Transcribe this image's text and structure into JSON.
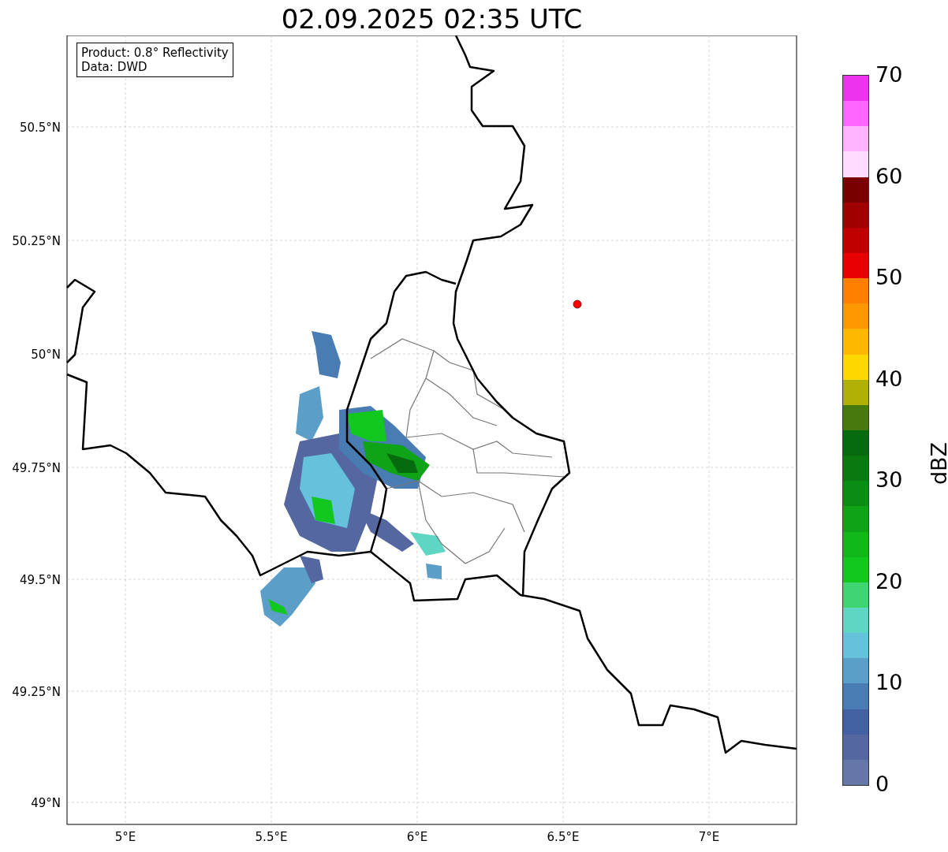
{
  "title": "02.09.2025 02:35 UTC",
  "legend": {
    "lines": [
      "Product: 0.8° Reflectivity",
      "Data: DWD"
    ]
  },
  "map": {
    "yticks": [
      "50.5°N",
      "50.25°N",
      "50°N",
      "49.75°N",
      "49.5°N",
      "49.25°N",
      "49°N"
    ],
    "xticks": [
      "5°E",
      "5.5°E",
      "6°E",
      "6.5°E",
      "7°E"
    ]
  },
  "colorbar": {
    "label": "dBZ",
    "ticks": [
      "70",
      "60",
      "50",
      "40",
      "30",
      "20",
      "10",
      "0"
    ],
    "segments": [
      {
        "color": "#6577a8"
      },
      {
        "color": "#5467a0"
      },
      {
        "color": "#4360a0"
      },
      {
        "color": "#4a7cb4"
      },
      {
        "color": "#5b9ec8"
      },
      {
        "color": "#66c2dc"
      },
      {
        "color": "#5fd6c4"
      },
      {
        "color": "#3dd673"
      },
      {
        "color": "#12c81e"
      },
      {
        "color": "#10b81a"
      },
      {
        "color": "#0fa318"
      },
      {
        "color": "#0b8c12"
      },
      {
        "color": "#0a7a10"
      },
      {
        "color": "#086a0e"
      },
      {
        "color": "#477a0e"
      },
      {
        "color": "#b0b006"
      },
      {
        "color": "#ffd700"
      },
      {
        "color": "#ffb800"
      },
      {
        "color": "#ff9800"
      },
      {
        "color": "#ff7f00"
      },
      {
        "color": "#e60000"
      },
      {
        "color": "#c00000"
      },
      {
        "color": "#a00000"
      },
      {
        "color": "#7a0000"
      },
      {
        "color": "#ffdcff"
      },
      {
        "color": "#ffb3ff"
      },
      {
        "color": "#ff66ff"
      },
      {
        "color": "#ee33ee"
      }
    ]
  }
}
